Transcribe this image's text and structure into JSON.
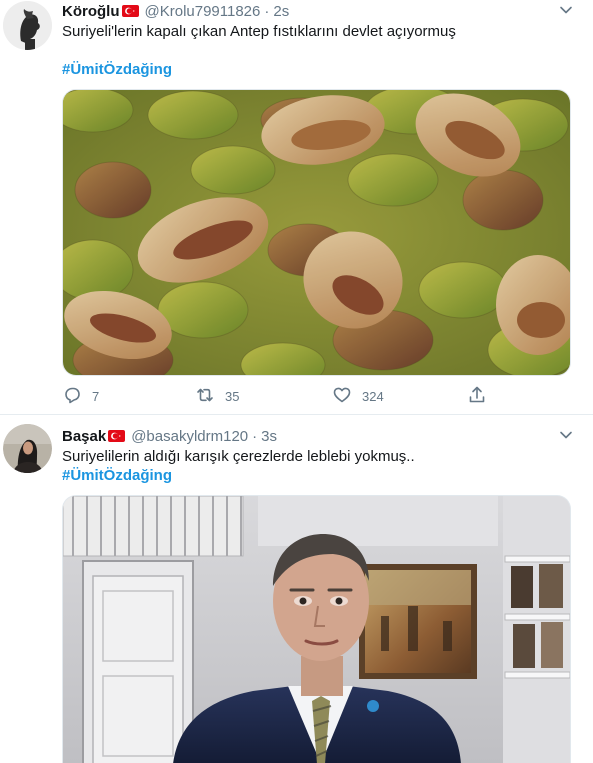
{
  "tweets": [
    {
      "display_name": "Köroğlu",
      "handle": "@Krolu79911826",
      "separator": "·",
      "time": "2s",
      "text": "Suriyeli'lerin kapalı çıkan Antep fıstıklarını devlet açıyormuş",
      "hashtag": "#ÜmitÖzdağing",
      "reply_count": "7",
      "retweet_count": "35",
      "like_count": "324"
    },
    {
      "display_name": "Başak",
      "handle": "@basakyldrm120",
      "separator": "·",
      "time": "3s",
      "text": "Suriyelilerin aldığı karışık çerezlerde leblebi yokmuş..",
      "hashtag": "#ÜmitÖzdağing"
    }
  ],
  "colors": {
    "accent": "#1b95e0",
    "muted": "#657786",
    "flag_red": "#e30a17",
    "divider": "#e6ecf0"
  },
  "icons": [
    "caret-down-icon",
    "reply-icon",
    "retweet-icon",
    "like-icon",
    "share-icon",
    "turkish-flag-icon"
  ]
}
